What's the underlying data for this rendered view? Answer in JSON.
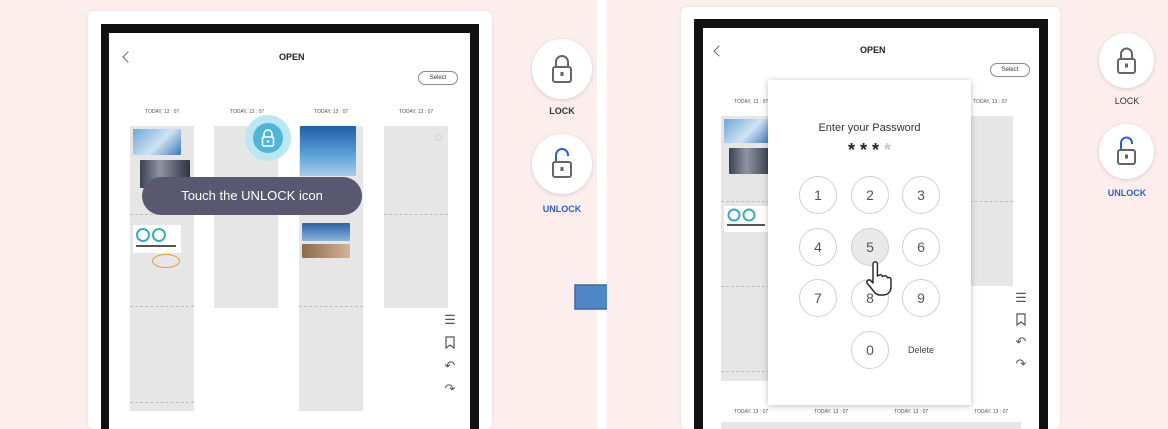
{
  "left": {
    "screen_title": "OPEN",
    "select_label": "Select",
    "dates": [
      "TODAY, 13 : 07",
      "TODAY, 13 : 07",
      "TODAY, 13 : 07",
      "TODAY, 13 : 07"
    ],
    "tooltip": "Touch the UNLOCK icon",
    "lock_label": "LOCK",
    "unlock_label": "UNLOCK"
  },
  "right": {
    "screen_title": "OPEN",
    "select_label": "Select",
    "dates_top": [
      "TODAY, 13 : 07",
      "TODAY, 13 : 07"
    ],
    "dates_bottom": [
      "TODAY, 13 : 07",
      "TODAY, 13 : 07",
      "TODAY, 13 : 07",
      "TODAY, 13 : 07"
    ],
    "password_title": "Enter your Password",
    "masked": "* * *",
    "masked_pending": "*",
    "keys": [
      "1",
      "2",
      "3",
      "4",
      "5",
      "6",
      "7",
      "8",
      "9",
      "0"
    ],
    "delete_label": "Delete",
    "lock_label": "LOCK",
    "unlock_label": "UNLOCK"
  },
  "colors": {
    "background": "#fdeeee",
    "unlock_blue": "#2f5fd0",
    "arrow_blue": "#4f86c6",
    "tooltip_bg": "#5a5870",
    "highlight_ring": "#bde6f3"
  }
}
